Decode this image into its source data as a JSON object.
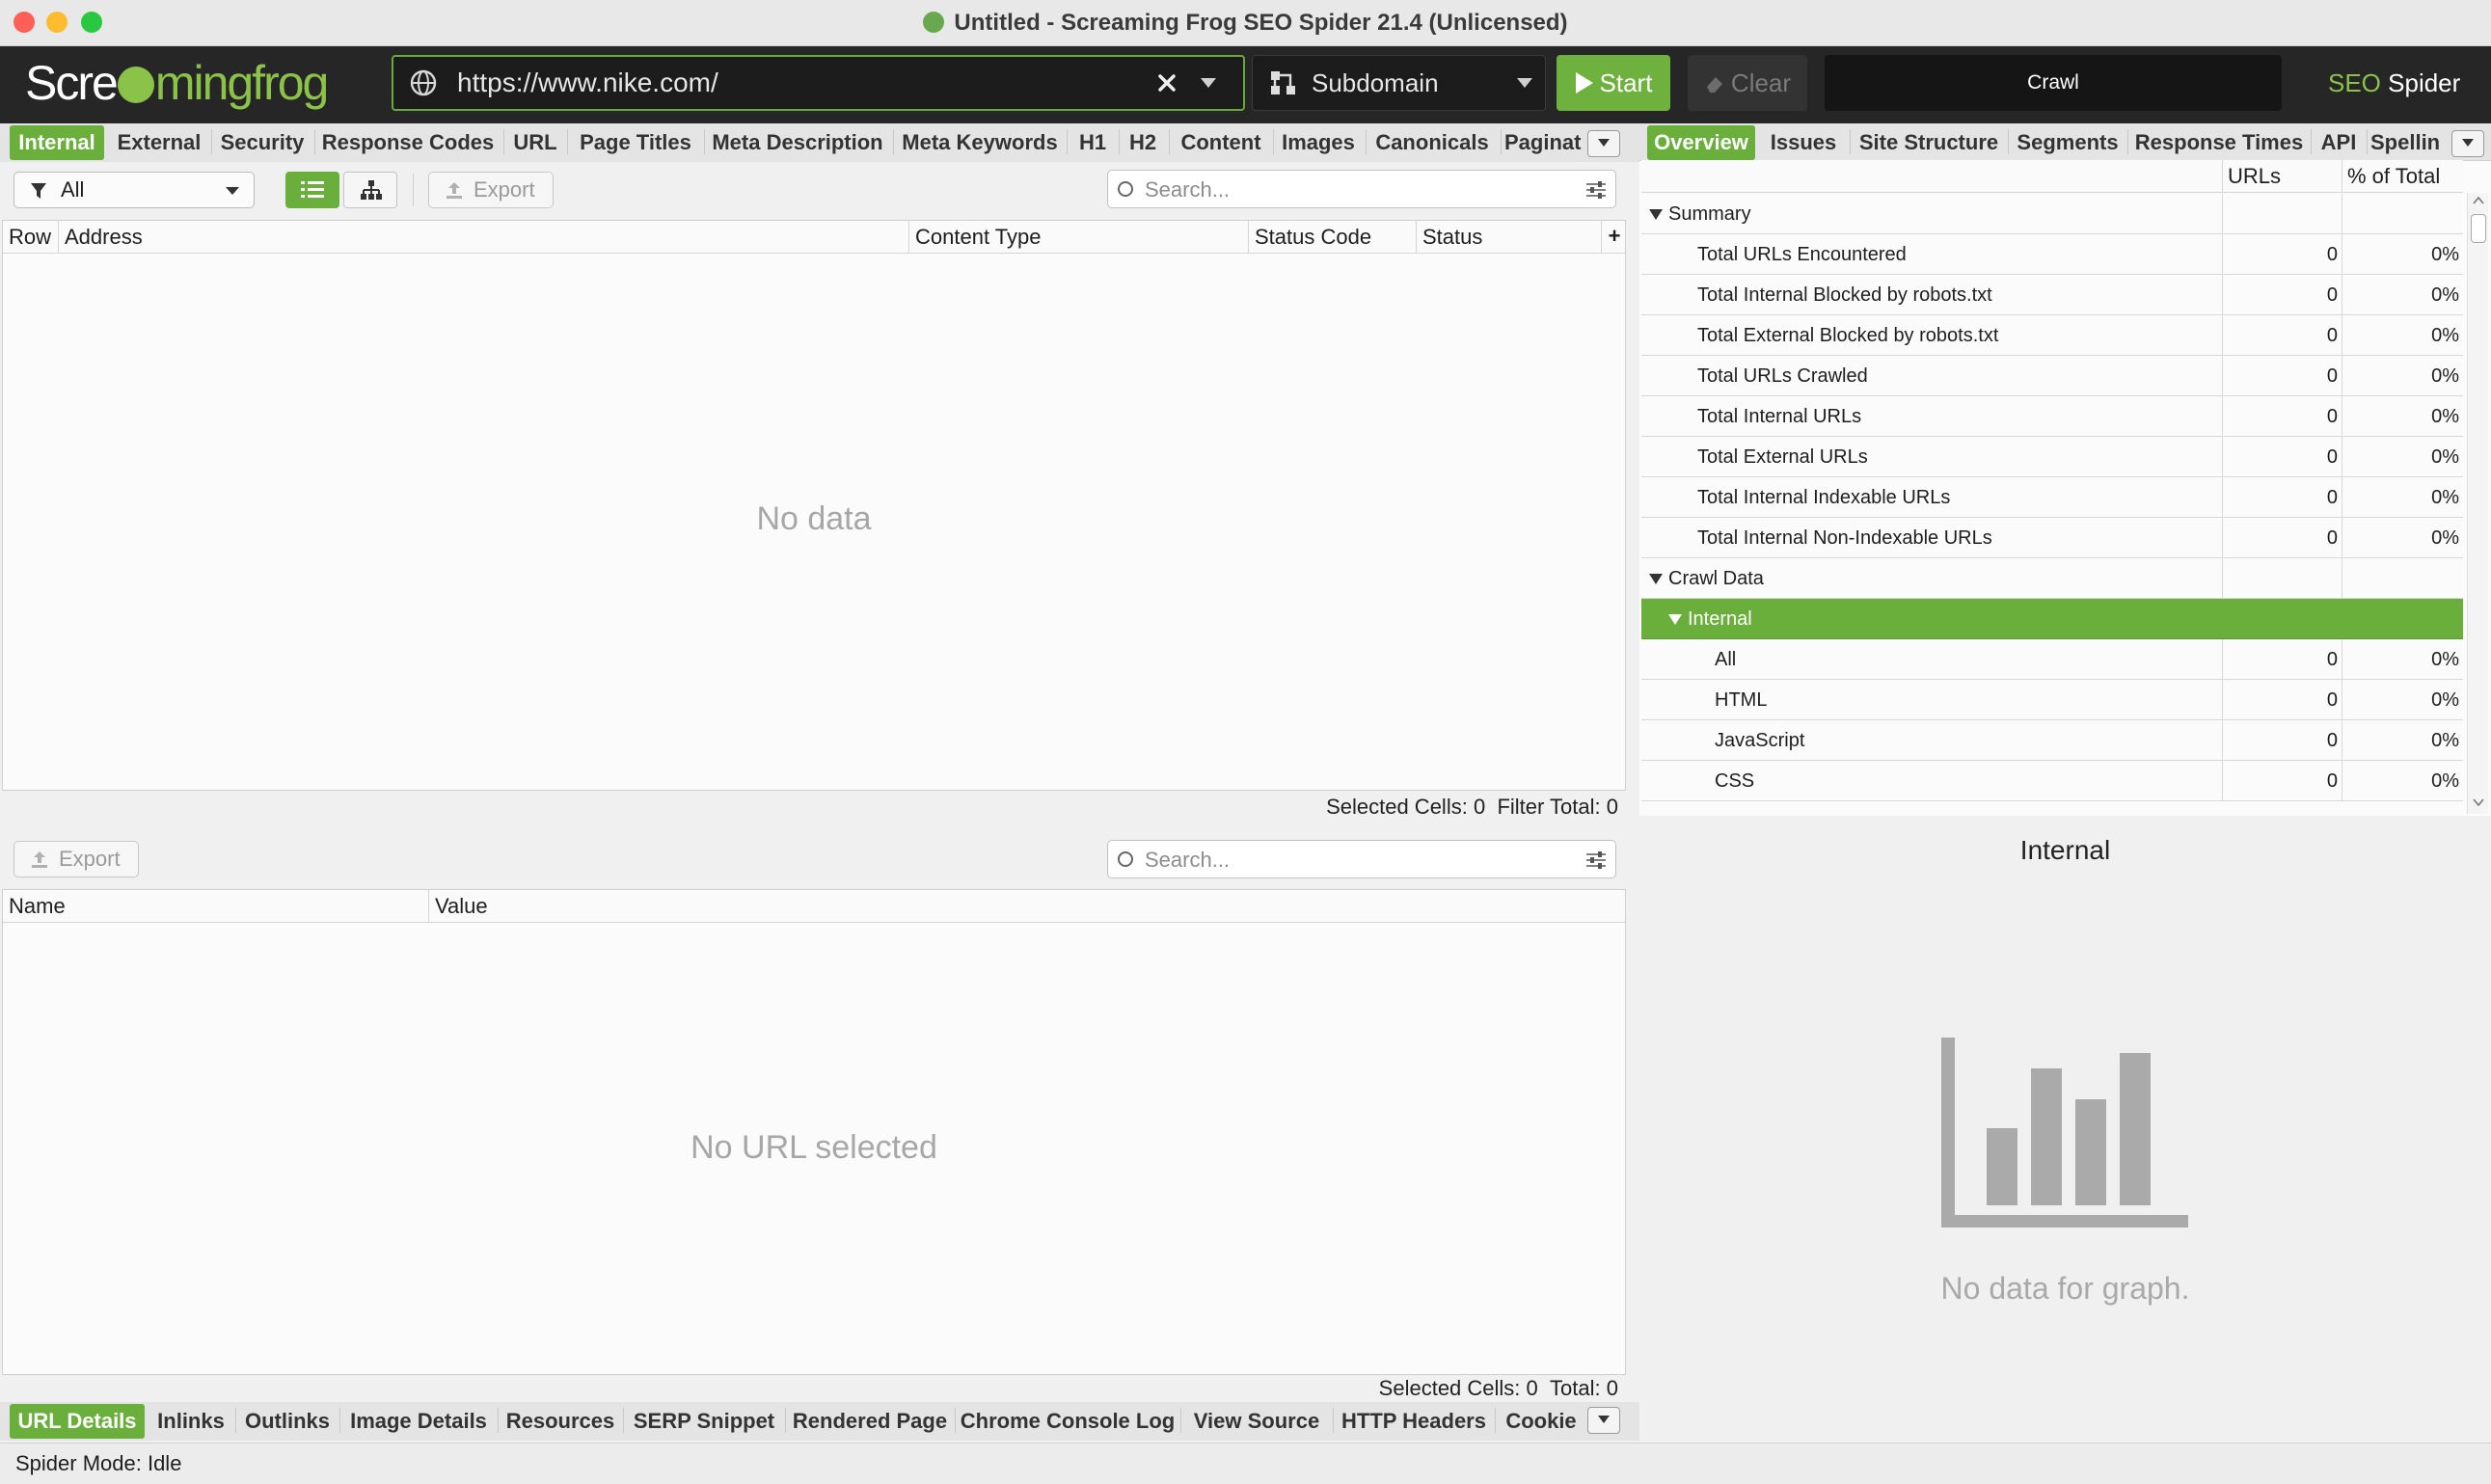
{
  "window": {
    "title": "Untitled - Screaming Frog SEO Spider 21.4 (Unlicensed)"
  },
  "toolbar": {
    "logo_left": "Scre",
    "logo_right": "mingfrog",
    "url": "https://www.nike.com/",
    "mode": "Subdomain",
    "start_label": "Start",
    "clear_label": "Clear",
    "crawl_label": "Crawl",
    "brand_seo": "SEO",
    "brand_spider": " Spider"
  },
  "main_tabs": [
    "Internal",
    "External",
    "Security",
    "Response Codes",
    "URL",
    "Page Titles",
    "Meta Description",
    "Meta Keywords",
    "H1",
    "H2",
    "Content",
    "Images",
    "Canonicals",
    "Paginat"
  ],
  "filter": {
    "selected": "All",
    "export_label": "Export",
    "search_placeholder": "Search..."
  },
  "main_table": {
    "columns": [
      "Row",
      "Address",
      "Content Type",
      "Status Code",
      "Status"
    ],
    "empty_message": "No data",
    "status_selected_label": "Selected Cells:",
    "status_selected_value": "0",
    "status_total_label": "Filter Total:",
    "status_total_value": "0"
  },
  "detail": {
    "export_label": "Export",
    "search_placeholder": "Search...",
    "columns": [
      "Name",
      "Value"
    ],
    "empty_message": "No URL selected",
    "status_selected_label": "Selected Cells:",
    "status_selected_value": "0",
    "status_total_label": "Total:",
    "status_total_value": "0"
  },
  "bottom_tabs": [
    "URL Details",
    "Inlinks",
    "Outlinks",
    "Image Details",
    "Resources",
    "SERP Snippet",
    "Rendered Page",
    "Chrome Console Log",
    "View Source",
    "HTTP Headers",
    "Cookie"
  ],
  "right_tabs": [
    "Overview",
    "Issues",
    "Site Structure",
    "Segments",
    "Response Times",
    "API",
    "Spellin"
  ],
  "overview": {
    "col_urls": "URLs",
    "col_pct": "% of Total",
    "rows": [
      {
        "label": "Summary",
        "level": 0,
        "group": true
      },
      {
        "label": "Total URLs Encountered",
        "urls": "0",
        "pct": "0%"
      },
      {
        "label": "Total Internal Blocked by robots.txt",
        "urls": "0",
        "pct": "0%"
      },
      {
        "label": "Total External Blocked by robots.txt",
        "urls": "0",
        "pct": "0%"
      },
      {
        "label": "Total URLs Crawled",
        "urls": "0",
        "pct": "0%"
      },
      {
        "label": "Total Internal URLs",
        "urls": "0",
        "pct": "0%"
      },
      {
        "label": "Total External URLs",
        "urls": "0",
        "pct": "0%"
      },
      {
        "label": "Total Internal Indexable URLs",
        "urls": "0",
        "pct": "0%"
      },
      {
        "label": "Total Internal Non-Indexable URLs",
        "urls": "0",
        "pct": "0%"
      },
      {
        "label": "Crawl Data",
        "level": 0,
        "group": true
      },
      {
        "label": "Internal",
        "level": 1,
        "group": true,
        "selected": true
      },
      {
        "label": "All",
        "urls": "0",
        "pct": "0%"
      },
      {
        "label": "HTML",
        "urls": "0",
        "pct": "0%"
      },
      {
        "label": "JavaScript",
        "urls": "0",
        "pct": "0%"
      },
      {
        "label": "CSS",
        "urls": "0",
        "pct": "0%"
      }
    ]
  },
  "graph": {
    "title": "Internal",
    "empty_message": "No data for graph."
  },
  "statusbar": {
    "text": "Spider Mode: Idle"
  },
  "colors": {
    "accent": "#6aaf3c",
    "toolbar_bg": "#262626"
  }
}
